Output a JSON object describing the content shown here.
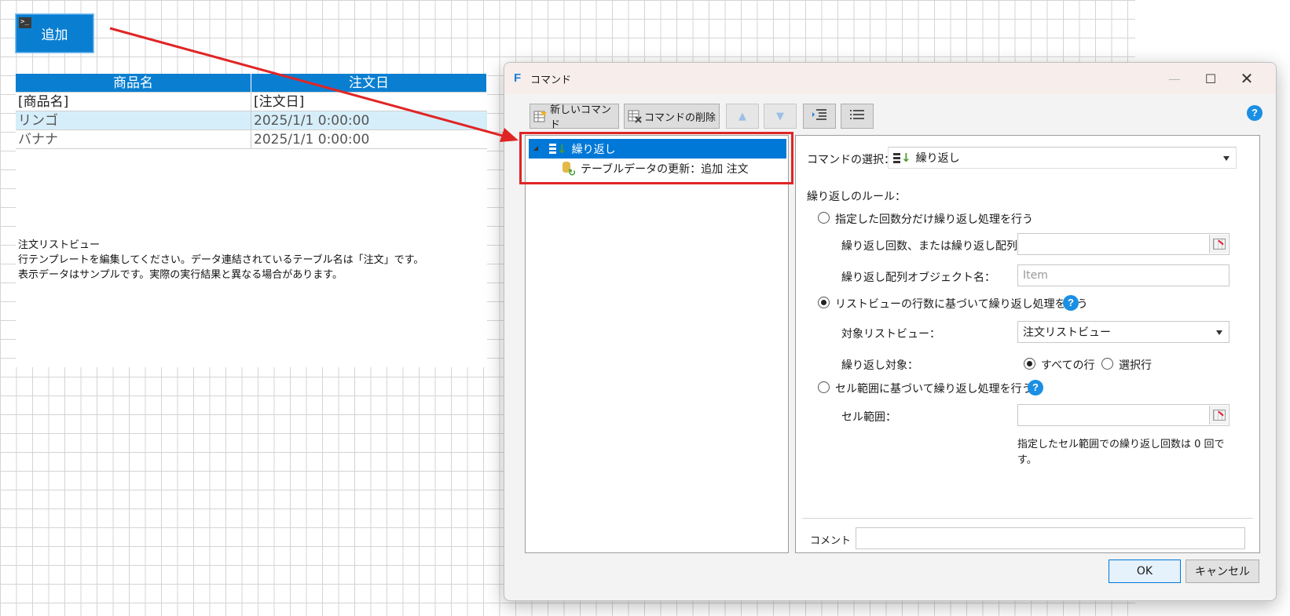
{
  "sheet": {
    "add_button_label": "追加",
    "table_headers": [
      "商品名",
      "注文日"
    ],
    "template_row": [
      "[商品名]",
      "[注文日]"
    ],
    "rows": [
      [
        "リンゴ",
        "2025/1/1 0:00:00"
      ],
      [
        "バナナ",
        "2025/1/1 0:00:00"
      ]
    ],
    "listview_note": [
      "注文リストビュー",
      "行テンプレートを編集してください。データ連結されているテーブル名は「注文」です。",
      "表示データはサンプルです。実際の実行結果と異なる場合があります。"
    ]
  },
  "dialog": {
    "app_icon": "F",
    "title": "コマンド",
    "window_controls": {
      "minimize": "—",
      "maximize": "☐",
      "close": "✕"
    },
    "toolbar": {
      "new_command": "新しいコマンド",
      "delete_command": "コマンドの削除",
      "move_up": "▲",
      "move_down": "▼",
      "help": "?"
    },
    "tree": [
      {
        "label": "繰り返し",
        "selected": true
      },
      {
        "label": "テーブルデータの更新：追加 注文",
        "selected": false
      }
    ],
    "properties": {
      "command_select_label": "コマンドの選択：",
      "command_select_value": "繰り返し",
      "loop_rule_label": "繰り返しのルール：",
      "option_count": {
        "label": "指定した回数分だけ繰り返し処理を行う",
        "checked": false,
        "count_label": "繰り返し回数、または繰り返し配列：",
        "count_value": "",
        "object_name_label": "繰り返し配列オブジェクト名：",
        "object_name_placeholder": "Item"
      },
      "option_listview": {
        "label": "リストビューの行数に基づいて繰り返し処理を行う",
        "checked": true,
        "target_label": "対象リストビュー：",
        "target_value": "注文リストビュー",
        "scope_label": "繰り返し対象：",
        "scope_all": "すべての行",
        "scope_selected": "選択行",
        "scope_value": "すべての行"
      },
      "option_range": {
        "label": "セル範囲に基づいて繰り返し処理を行う",
        "checked": false,
        "range_label": "セル範囲：",
        "range_value": "",
        "note": "指定したセル範囲での繰り返し回数は 0 回です。"
      },
      "comment_label": "コメント",
      "comment_value": ""
    },
    "buttons": {
      "ok": "OK",
      "cancel": "キャンセル"
    }
  },
  "colors": {
    "accent": "#0a7fd1",
    "selection": "#0078d7",
    "annotation_red": "#e02525",
    "help_blue": "#1a8fe3"
  }
}
